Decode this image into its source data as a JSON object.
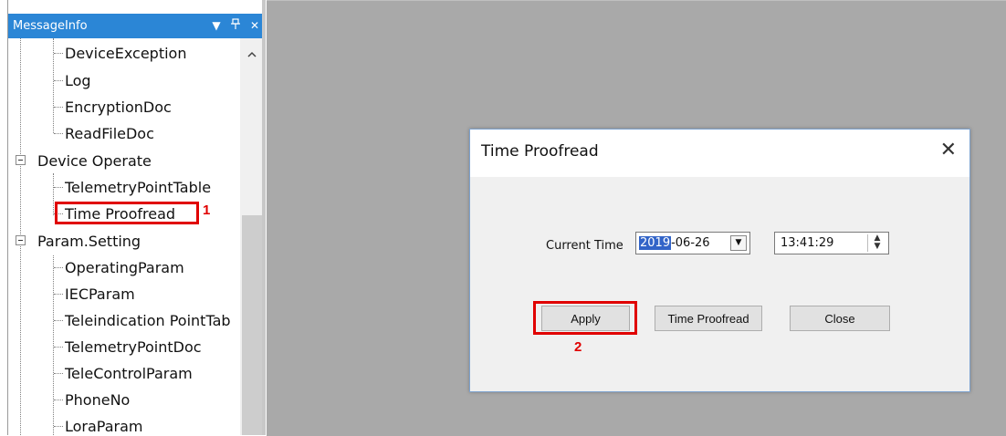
{
  "panel": {
    "title": "MessageInfo",
    "buttons": {
      "dropdown": "▼",
      "pin": "ᵖ",
      "close": "✕"
    },
    "tree": {
      "items": [
        {
          "label": "DeviceException"
        },
        {
          "label": "Log"
        },
        {
          "label": "EncryptionDoc"
        },
        {
          "label": "ReadFileDoc"
        },
        {
          "label": "Device Operate"
        },
        {
          "label": "TelemetryPointTable"
        },
        {
          "label": "Time Proofread"
        },
        {
          "label": "Param.Setting"
        },
        {
          "label": "OperatingParam"
        },
        {
          "label": "IECParam"
        },
        {
          "label": "Teleindication PointTab"
        },
        {
          "label": "TelemetryPointDoc"
        },
        {
          "label": "TeleControlParam"
        },
        {
          "label": "PhoneNo"
        },
        {
          "label": "LoraParam"
        }
      ]
    },
    "annotation_1": "1"
  },
  "dialog": {
    "title": "Time Proofread",
    "close_glyph": "✕",
    "current_time_label": "Current Time",
    "date_year_selected": "2019",
    "date_rest": "-06-26",
    "time_value": "13:41:29",
    "apply_label": "Apply",
    "time_proofread_label": "Time Proofread",
    "close_label": "Close",
    "annotation_2": "2"
  },
  "colors": {
    "panel_header": "#2b86d6",
    "workspace": "#a9a9a9",
    "annotation_red": "#e00000",
    "selection_blue": "#3264c8"
  }
}
